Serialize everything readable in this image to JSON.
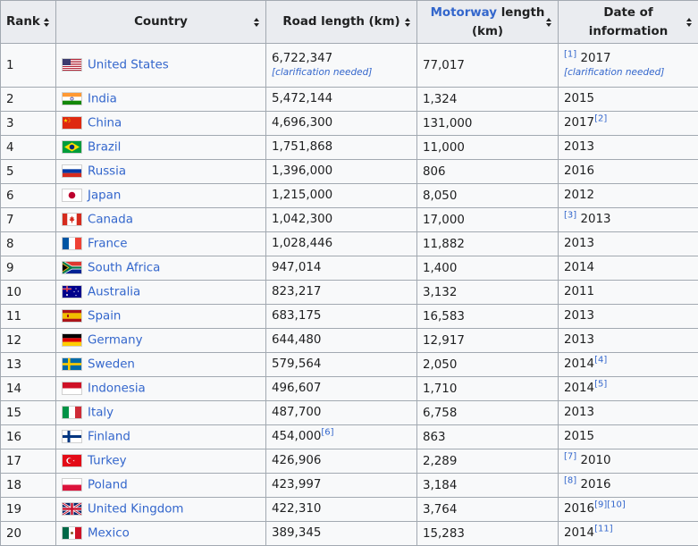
{
  "headers": {
    "rank": "Rank",
    "country": "Country",
    "road": "Road length (km)",
    "motorway_link": "Motorway",
    "motorway_rest": " length (km)",
    "date": "Date of information"
  },
  "rows": [
    {
      "rank": "1",
      "country": "United States",
      "flag": "us-flag-icon",
      "road": "6,722,347",
      "road_note": "[clarification needed]",
      "road_ref": "",
      "motorway": "77,017",
      "date_pre": "[1]",
      "date": "2017",
      "date_post": "",
      "date_note": "[clarification needed]"
    },
    {
      "rank": "2",
      "country": "India",
      "flag": "india-flag-icon",
      "road": "5,472,144",
      "road_note": "",
      "road_ref": "",
      "motorway": "1,324",
      "date_pre": "",
      "date": "2015",
      "date_post": "",
      "date_note": ""
    },
    {
      "rank": "3",
      "country": "China",
      "flag": "china-flag-icon",
      "road": "4,696,300",
      "road_note": "",
      "road_ref": "",
      "motorway": "131,000",
      "date_pre": "",
      "date": "2017",
      "date_post": "[2]",
      "date_note": ""
    },
    {
      "rank": "4",
      "country": "Brazil",
      "flag": "brazil-flag-icon",
      "road": "1,751,868",
      "road_note": "",
      "road_ref": "",
      "motorway": "11,000",
      "date_pre": "",
      "date": "2013",
      "date_post": "",
      "date_note": ""
    },
    {
      "rank": "5",
      "country": "Russia",
      "flag": "russia-flag-icon",
      "road": "1,396,000",
      "road_note": "",
      "road_ref": "",
      "motorway": "806",
      "date_pre": "",
      "date": "2016",
      "date_post": "",
      "date_note": ""
    },
    {
      "rank": "6",
      "country": "Japan",
      "flag": "japan-flag-icon",
      "road": "1,215,000",
      "road_note": "",
      "road_ref": "",
      "motorway": "8,050",
      "date_pre": "",
      "date": "2012",
      "date_post": "",
      "date_note": ""
    },
    {
      "rank": "7",
      "country": "Canada",
      "flag": "canada-flag-icon",
      "road": "1,042,300",
      "road_note": "",
      "road_ref": "",
      "motorway": "17,000",
      "date_pre": "[3]",
      "date": "2013",
      "date_post": "",
      "date_note": ""
    },
    {
      "rank": "8",
      "country": "France",
      "flag": "france-flag-icon",
      "road": "1,028,446",
      "road_note": "",
      "road_ref": "",
      "motorway": "11,882",
      "date_pre": "",
      "date": "2013",
      "date_post": "",
      "date_note": ""
    },
    {
      "rank": "9",
      "country": "South Africa",
      "flag": "south-africa-flag-icon",
      "road": "947,014",
      "road_note": "",
      "road_ref": "",
      "motorway": "1,400",
      "date_pre": "",
      "date": "2014",
      "date_post": "",
      "date_note": ""
    },
    {
      "rank": "10",
      "country": "Australia",
      "flag": "australia-flag-icon",
      "road": "823,217",
      "road_note": "",
      "road_ref": "",
      "motorway": "3,132",
      "date_pre": "",
      "date": "2011",
      "date_post": "",
      "date_note": ""
    },
    {
      "rank": "11",
      "country": "Spain",
      "flag": "spain-flag-icon",
      "road": "683,175",
      "road_note": "",
      "road_ref": "",
      "motorway": "16,583",
      "date_pre": "",
      "date": "2013",
      "date_post": "",
      "date_note": ""
    },
    {
      "rank": "12",
      "country": "Germany",
      "flag": "germany-flag-icon",
      "road": "644,480",
      "road_note": "",
      "road_ref": "",
      "motorway": "12,917",
      "date_pre": "",
      "date": "2013",
      "date_post": "",
      "date_note": ""
    },
    {
      "rank": "13",
      "country": "Sweden",
      "flag": "sweden-flag-icon",
      "road": "579,564",
      "road_note": "",
      "road_ref": "",
      "motorway": "2,050",
      "date_pre": "",
      "date": "2014",
      "date_post": "[4]",
      "date_note": ""
    },
    {
      "rank": "14",
      "country": "Indonesia",
      "flag": "indonesia-flag-icon",
      "road": "496,607",
      "road_note": "",
      "road_ref": "",
      "motorway": "1,710",
      "date_pre": "",
      "date": "2014",
      "date_post": "[5]",
      "date_note": ""
    },
    {
      "rank": "15",
      "country": "Italy",
      "flag": "italy-flag-icon",
      "road": "487,700",
      "road_note": "",
      "road_ref": "",
      "motorway": "6,758",
      "date_pre": "",
      "date": "2013",
      "date_post": "",
      "date_note": ""
    },
    {
      "rank": "16",
      "country": "Finland",
      "flag": "finland-flag-icon",
      "road": "454,000",
      "road_note": "",
      "road_ref": "[6]",
      "motorway": "863",
      "date_pre": "",
      "date": "2015",
      "date_post": "",
      "date_note": ""
    },
    {
      "rank": "17",
      "country": "Turkey",
      "flag": "turkey-flag-icon",
      "road": "426,906",
      "road_note": "",
      "road_ref": "",
      "motorway": "2,289",
      "date_pre": "[7]",
      "date": "2010",
      "date_post": "",
      "date_note": ""
    },
    {
      "rank": "18",
      "country": "Poland",
      "flag": "poland-flag-icon",
      "road": "423,997",
      "road_note": "",
      "road_ref": "",
      "motorway": "3,184",
      "date_pre": "[8]",
      "date": "2016",
      "date_post": "",
      "date_note": ""
    },
    {
      "rank": "19",
      "country": "United Kingdom",
      "flag": "uk-flag-icon",
      "road": "422,310",
      "road_note": "",
      "road_ref": "",
      "motorway": "3,764",
      "date_pre": "",
      "date": "2016",
      "date_post": "[9][10]",
      "date_note": ""
    },
    {
      "rank": "20",
      "country": "Mexico",
      "flag": "mexico-flag-icon",
      "road": "389,345",
      "road_note": "",
      "road_ref": "",
      "motorway": "15,283",
      "date_pre": "",
      "date": "2014",
      "date_post": "[11]",
      "date_note": ""
    }
  ],
  "colors": {
    "link": "#3366cc",
    "header_bg": "#eaecf0",
    "cell_bg": "#f8f9fa",
    "border": "#a2a9b1"
  }
}
